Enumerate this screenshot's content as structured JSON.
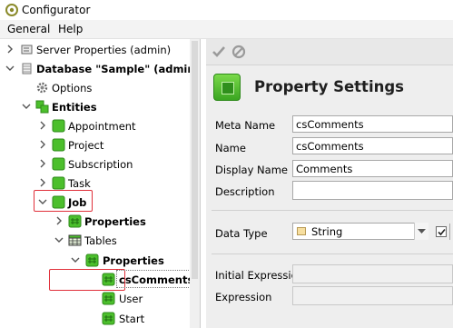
{
  "window": {
    "title": "Configurator"
  },
  "menu": [
    {
      "label": "General"
    },
    {
      "label": "Help"
    }
  ],
  "tree": {
    "items": [
      {
        "label": "Server Properties (admin)"
      },
      {
        "label": "Database \"Sample\" (admin)"
      },
      {
        "label": "Options"
      },
      {
        "label": "Entities"
      },
      {
        "label": "Appointment"
      },
      {
        "label": "Project"
      },
      {
        "label": "Subscription"
      },
      {
        "label": "Task"
      },
      {
        "label": "Job"
      },
      {
        "label": "Properties"
      },
      {
        "label": "Tables"
      },
      {
        "label": "Properties"
      },
      {
        "label": "csComments"
      },
      {
        "label": "User"
      },
      {
        "label": "Start"
      }
    ]
  },
  "panel": {
    "title": "Property Settings",
    "fields": {
      "meta_name": {
        "label": "Meta Name",
        "value": "csComments"
      },
      "name": {
        "label": "Name",
        "value": "csComments"
      },
      "display_name": {
        "label": "Display Name",
        "value": "Comments"
      },
      "description": {
        "label": "Description",
        "value": ""
      },
      "data_type": {
        "label": "Data Type",
        "value": "String"
      },
      "initial_expression": {
        "label": "Initial Expression",
        "value": ""
      },
      "expression": {
        "label": "Expression",
        "value": ""
      }
    }
  },
  "colors": {
    "highlight": "#e0303a",
    "entity_green": "#3aa521"
  }
}
